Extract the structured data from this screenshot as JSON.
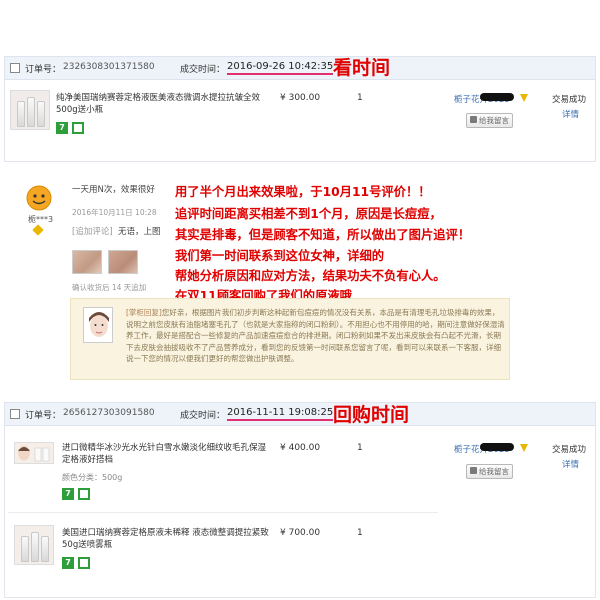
{
  "order1": {
    "order_no_label": "订单号：",
    "order_no": "2326308301371580",
    "deal_time_label": "成交时间：",
    "deal_time": "2016-09-26 10:42:35",
    "annotation": "看时间",
    "product_title": "纯净美国瑞纳赛蓉定格液医美液态微调水提拉抗皱全效500g送小瓶",
    "price": "¥ 300.00",
    "qty": "1",
    "buyer": "栀子花开2023",
    "memo_btn": "给我留言",
    "status": "交易成功",
    "detail": "详情"
  },
  "review": {
    "nickname": "栀***3",
    "first_line": "一天用N次，效果很好",
    "date": "2016年10月11日 10:28",
    "append_label": "[追加评论]",
    "append_text": "无语，上图",
    "append_note": "确认收货后  14 天追加",
    "reply_label": "[掌柜回复]",
    "reply_text": "您好亲，根据图片我们初步判断这种起新包痘痘的情况没有关系，本品是有清理毛孔垃圾排毒的效果，说明之前您皮肤有油脂堵塞毛孔了（也就是大家指称的闭口粉刺）。不用担心也不用停用的哈，期间注意做好保湿清养工作，最好是搭配合一些修复的产品加速痘痘愈合的排泄期。闭口粉刺如果不发出来皮肤会有凸起不光滑，长期下去皮肤会抽拔吸收不了产品营养成分，看到您的反馈第一时间联系您留言了呢，看到可以来联系一下客服，详细说一下您的情况以便我们更好的帮您做出护肤调整。"
  },
  "annotation_lines": [
    "用了半个月出来效果啦，于10月11号评价！！",
    "追评时间距离买相差不到1个月，原因是长痘痘，",
    "其实是排毒，但是顾客不知道，所以做出了图片追评！",
    "我们第一时间联系到这位女神，详细的",
    "帮她分析原因和应对方法，结果功夫不负有心人。",
    "在双11顾客回购了我们的原液哦"
  ],
  "order2": {
    "order_no_label": "订单号：",
    "order_no": "2656127303091580",
    "deal_time_label": "成交时间：",
    "deal_time": "2016-11-11 19:08:25",
    "annotation": "回购时间",
    "buyer": "栀子花开2023",
    "memo_btn": "给我留言",
    "status": "交易成功",
    "detail": "详情",
    "items": [
      {
        "title": "进口微精华冰沙光水光针白雪水嫩淡化细纹收毛孔保湿定格液好搭档",
        "color_label": "颜色分类：500g",
        "price": "¥ 400.00",
        "qty": "1"
      },
      {
        "title": "美国进口瑞纳赛蓉定格原液未稀释 液态微整调提拉紧致50g送喷雾瓶",
        "price": "¥ 700.00",
        "qty": "1"
      }
    ]
  },
  "colors": {
    "annotation_red": "#e00000",
    "underline_pink": "#e03070",
    "bar_bg": "#eef3f9",
    "link_blue": "#3a6fb0",
    "badge_green": "#2e9e3a",
    "reply_bg": "#faf3df"
  }
}
